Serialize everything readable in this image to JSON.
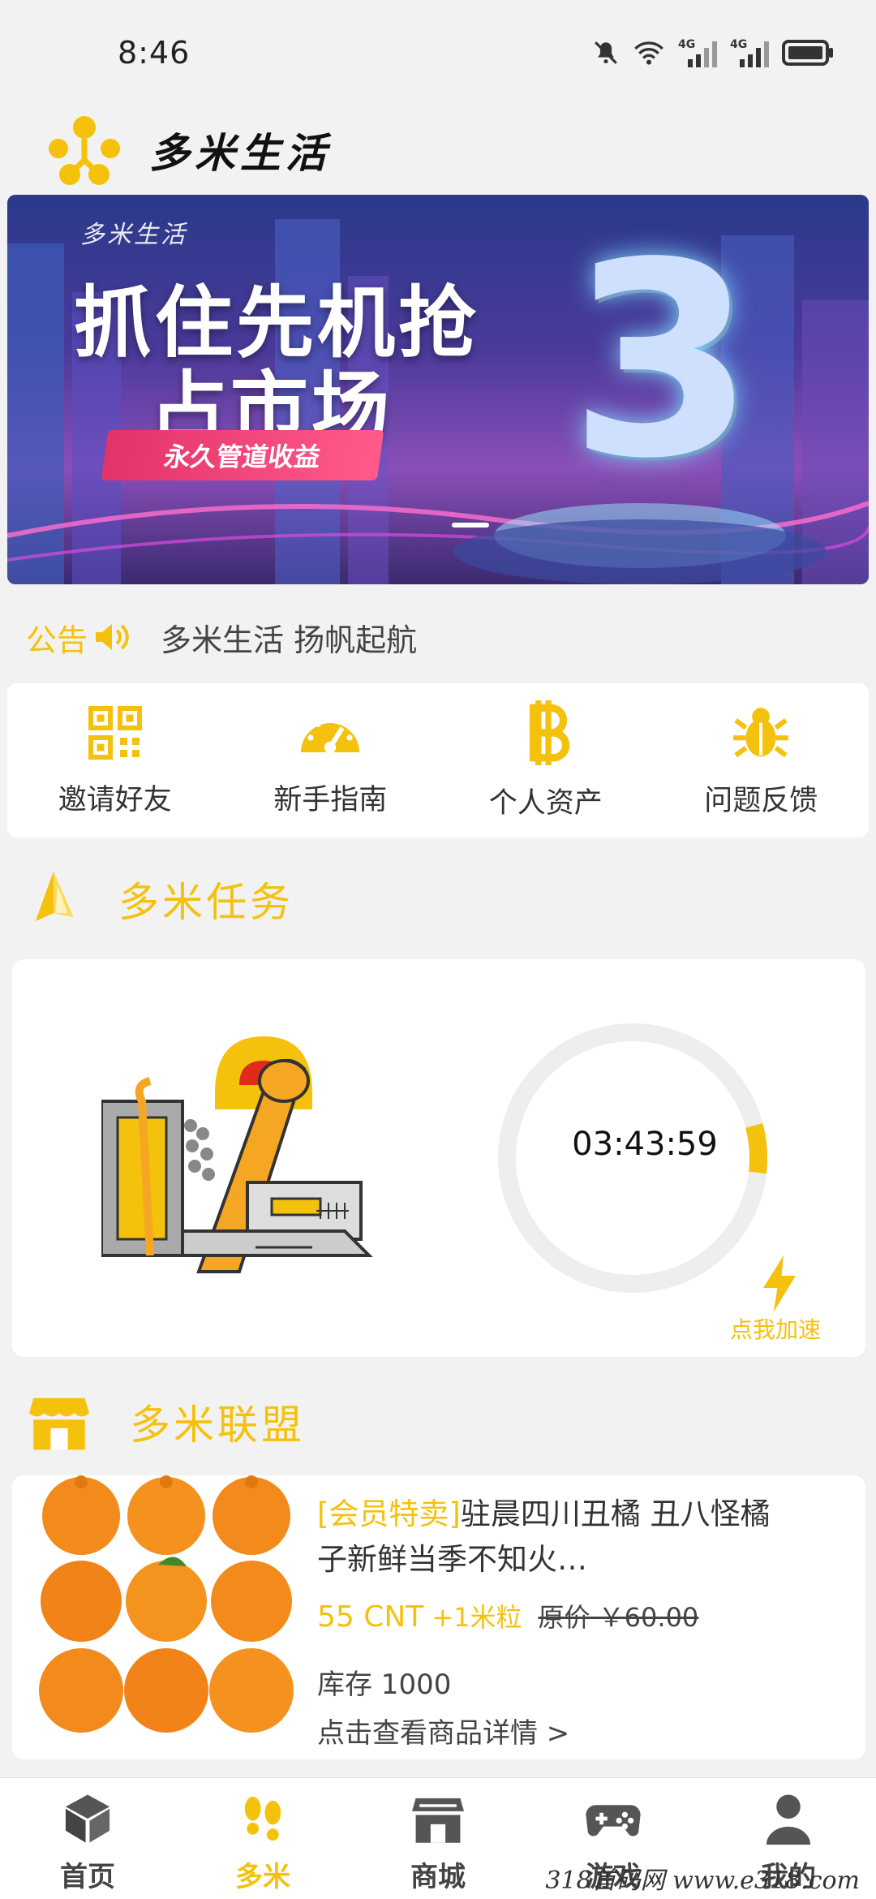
{
  "status_bar": {
    "time": "8:46",
    "network_label_1": "4G",
    "network_label_2": "4G"
  },
  "header": {
    "app_name": "多米生活"
  },
  "banner": {
    "brand": "多米生活",
    "title_line_1": "抓住先机抢",
    "title_line_2": "占市场",
    "ribbon": "永久管道收益",
    "big_number": "3"
  },
  "notice": {
    "label": "公告",
    "text": "多米生活 扬帆起航"
  },
  "shortcuts": [
    {
      "label": "邀请好友",
      "icon": "qr-code-icon"
    },
    {
      "label": "新手指南",
      "icon": "speedometer-icon"
    },
    {
      "label": "个人资产",
      "icon": "bitcoin-icon"
    },
    {
      "label": "问题反馈",
      "icon": "bug-icon"
    }
  ],
  "task_section": {
    "title": "多米任务",
    "timer": "03:43:59",
    "progress": 0.06,
    "boost_label": "点我加速"
  },
  "alliance_section": {
    "title": "多米联盟"
  },
  "product": {
    "tag": "[会员特卖]",
    "title": "驻晨四川丑橘 丑八怪橘子新鲜当季不知火…",
    "price": "55 CNT",
    "bonus": "+1米粒",
    "original_price": "原价 ￥60.00",
    "stock": "库存 1000",
    "link": "点击查看商品详情 >"
  },
  "bottom_nav": [
    {
      "label": "首页",
      "icon": "cube-icon",
      "active": false
    },
    {
      "label": "多米",
      "icon": "footprints-icon",
      "active": true
    },
    {
      "label": "商城",
      "icon": "store-icon",
      "active": false
    },
    {
      "label": "游戏",
      "icon": "gamepad-icon",
      "active": false
    },
    {
      "label": "我的",
      "icon": "person-icon",
      "active": false
    }
  ],
  "watermark": "318首码网 www.e318.com",
  "colors": {
    "accent": "#f4c20d",
    "background": "#f2f2f2",
    "card": "#ffffff"
  }
}
